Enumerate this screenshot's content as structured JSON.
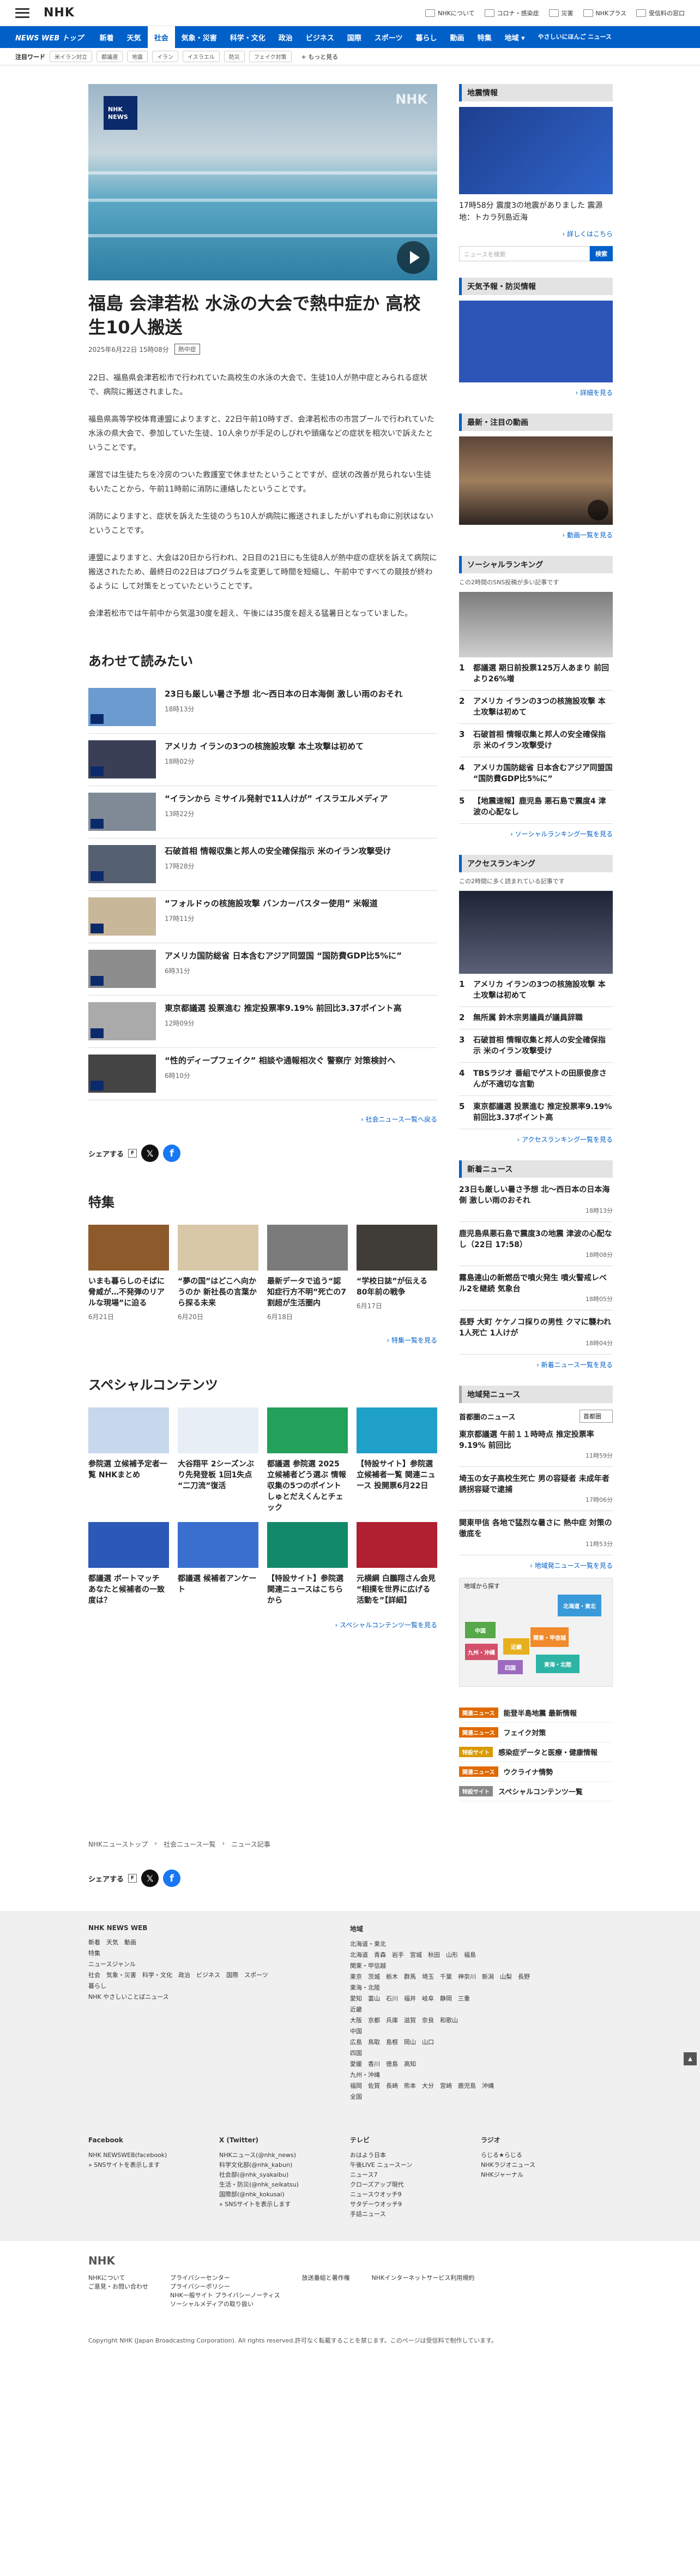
{
  "top": {
    "logo": "NHK",
    "links": [
      "NHKについて",
      "コロナ・感染症",
      "災害",
      "NHKプラス",
      "受信料の窓口"
    ]
  },
  "nav": {
    "brand": "NEWS WEB トップ",
    "items": [
      "新着",
      "天気",
      "社会",
      "気象・災害",
      "科学・文化",
      "政治",
      "ビジネス",
      "国際",
      "スポーツ",
      "暮らし",
      "動画",
      "特集",
      "地域 ▾"
    ],
    "active": "社会",
    "last": "やさしいにほんご ニュース"
  },
  "trend": {
    "label": "注目ワード",
    "chips": [
      "米イラン対立",
      "都議選",
      "地震",
      "イラン",
      "イスラエル",
      "防災",
      "フェイク対策"
    ],
    "more": "+ もっと見る"
  },
  "article": {
    "badge": "NHK NEWS",
    "watermark": "NHK",
    "title": "福島 会津若松 水泳の大会で熱中症か 高校生10人搬送",
    "date": "2025年6月22日 15時08分",
    "tag": "熱中症",
    "paras": [
      "22日、福島県会津若松市で行われていた高校生の水泳の大会で、生徒10人が熱中症とみられる症状で、病院に搬送されました。",
      "福島県高等学校体育連盟によりますと、22日午前10時すぎ、会津若松市の市営プールで行われていた水泳の県大会で、参加していた生徒、10人余りが手足のしびれや頭痛などの症状を相次いで訴えたということです。",
      "運営では生徒たちを冷房のついた救護室で休ませたということですが、症状の改善が見られない生徒もいたことから、午前11時前に消防に連絡したということです。",
      "消防によりますと、症状を訴えた生徒のうち10人が病院に搬送されましたがいずれも命に別状はないということです。",
      "連盟によりますと、大会は20日から行われ、2日目の21日にも生徒8人が熱中症の症状を訴えて病院に搬送されたため、最終日の22日はプログラムを変更して時間を短縮し、午前中ですべての競技が終わるように して対策をとっていたということです。",
      "会津若松市では午前中から気温30度を超え、午後には35度を超える猛暑日となっていました。"
    ]
  },
  "related": {
    "heading": "あわせて読みたい",
    "items": [
      {
        "t": "23日も厳しい暑さ予想 北～西日本の日本海側 激しい雨のおそれ",
        "d": "18時13分",
        "c": "#6c9bd0"
      },
      {
        "t": "アメリカ イランの3つの核施設攻撃 本土攻撃は初めて",
        "d": "18時02分",
        "c": "#3a3f55"
      },
      {
        "t": "“イランから ミサイル発射で11人けが” イスラエルメディア",
        "d": "13時22分",
        "c": "#7f8a96"
      },
      {
        "t": "石破首相 情報収集と邦人の安全確保指示 米のイラン攻撃受け",
        "d": "17時28分",
        "c": "#556070"
      },
      {
        "t": "“フォルドゥの核施設攻撃 バンカーバスター使用” 米報道",
        "d": "17時11分",
        "c": "#c9b79a"
      },
      {
        "t": "アメリカ国防総省 日本含むアジア同盟国 “国防費GDP比5%に”",
        "d": "6時31分",
        "c": "#8d8d8d"
      },
      {
        "t": "東京都議選 投票進む 推定投票率9.19% 前回比3.37ポイント高",
        "d": "12時09分",
        "c": "#aaa"
      },
      {
        "t": "“性的ディープフェイク” 相談や通報相次ぐ 警察庁 対策検討へ",
        "d": "6時10分",
        "c": "#444"
      }
    ],
    "more": "› 社会ニュース一覧へ戻る"
  },
  "share": {
    "label": "シェアする",
    "x": "𝕏",
    "f": "f",
    "fs": "F"
  },
  "tokushu": {
    "heading": "特集",
    "items": [
      {
        "t": "いまも暮らしのそばに脅威が…不発弾のリアルな現場”に迫る",
        "d": "6月21日",
        "c": "#8c5a2b"
      },
      {
        "t": "“夢の国”はどこへ向かうのか 新社長の言葉から探る未来",
        "d": "6月20日",
        "c": "#d8c8a8"
      },
      {
        "t": "最新データで追う“認知症行方不明”死亡の7割超が生活圏内",
        "d": "6月18日",
        "c": "#7a7a7a"
      },
      {
        "t": "“学校日誌”が伝える80年前の戦争",
        "d": "6月17日",
        "c": "#403c38"
      }
    ],
    "more": "› 特集一覧を見る"
  },
  "special": {
    "heading": "スペシャルコンテンツ",
    "items": [
      {
        "t": "参院選 立候補予定者一覧 NHKまとめ",
        "c": "#c7d7ec"
      },
      {
        "t": "大谷翔平 2シーズンぶり先発登板 1回1失点 “二刀流”復活",
        "c": "#e8eef6"
      },
      {
        "t": "都議選 参院選 2025 立候補者どう選ぶ 情報収集の5つのポイント しゅとだえくんとチェック",
        "c": "#23a05a"
      },
      {
        "t": "【特設サイト】参院選 立候補者一覧 関連ニュース 投開票6月22日",
        "c": "#1fa0c8"
      },
      {
        "t": "都議選 ボートマッチ あなたと候補者の一致度は？",
        "c": "#2c58b8"
      },
      {
        "t": "都議選 候補者アンケート",
        "c": "#3a6fd0"
      },
      {
        "t": "【特設サイト】参院選 関連ニュースはこちらから",
        "c": "#128a6a"
      },
      {
        "t": "元横綱 白鵬翔さん会見 “相撲を世界に広げる活動を”【詳細】",
        "c": "#b02030"
      }
    ],
    "more": "› スペシャルコンテンツ一覧を見る"
  },
  "side": {
    "quake": {
      "h": "地震情報",
      "cap": "17時58分 震度3の地震がありました 震源地：トカラ列島近海",
      "link": "› 詳しくはこちら",
      "ph": "ニュースを検索",
      "btn": "検索"
    },
    "weather": {
      "h": "天気予報・防災情報",
      "link": "› 詳細を見る"
    },
    "movie": {
      "h": "最新・注目の動画",
      "link": "› 動画一覧を見る"
    },
    "social": {
      "h": "ソーシャルランキング",
      "sub": "この2時間のSNS投稿が多い記事です",
      "items": [
        "都議選 期日前投票125万人あまり 前回より26%増",
        "アメリカ イランの3つの核施設攻撃 本土攻撃は初めて",
        "石破首相 情報収集と邦人の安全確保指示 米のイラン攻撃受け",
        "アメリカ国防総省 日本含むアジア同盟国 “国防費GDP比5%に”",
        "【地震速報】鹿児島 悪石島で震度4 津波の心配なし"
      ],
      "link": "› ソーシャルランキング一覧を見る"
    },
    "access": {
      "h": "アクセスランキング",
      "sub": "この2時間に多く読まれている記事です",
      "items": [
        "アメリカ イランの3つの核施設攻撃 本土攻撃は初めて",
        "無所属 鈴木宗男議員が議員辞職",
        "石破首相 情報収集と邦人の安全確保指示 米のイラン攻撃受け",
        "TBSラジオ 番組でゲストの田原俊彦さんが不適切な言動",
        "東京都議選 投票進む 推定投票率9.19% 前回比3.37ポイント高"
      ],
      "link": "› アクセスランキング一覧を見る"
    },
    "latest": {
      "h": "新着ニュース",
      "items": [
        {
          "t": "23日も厳しい暑さ予想 北～西日本の日本海側 激しい雨のおそれ",
          "d": "18時13分"
        },
        {
          "t": "鹿児島県悪石島で震度3の地震 津波の心配なし（22日 17:58）",
          "d": "18時08分"
        },
        {
          "t": "霧島連山の新燃岳で噴火発生 噴火警戒レベル2を継続 気象台",
          "d": "18時05分"
        },
        {
          "t": "長野 大町 ケケノコ採りの男性 クマに襲われ 1人死亡 1人けが",
          "d": "18時04分"
        }
      ],
      "link": "› 新着ニュース一覧を見る"
    },
    "region": {
      "h": "地域発ニュース",
      "label": "首都圏のニュース",
      "sel": "首都圏",
      "items": [
        {
          "t": "東京都議選 午前１１時時点 推定投票率 9.19% 前回比",
          "d": "11時59分"
        },
        {
          "t": "埼玉の女子高校生死亡 男の容疑者 未成年者誘拐容疑で逮捕",
          "d": "17時06分"
        },
        {
          "t": "関東甲信 各地で猛烈な暑さに 熱中症 対策の徹底を",
          "d": "11時53分"
        }
      ],
      "link": "› 地域発ニュース一覧を見る",
      "maptitle": "地域から探す",
      "prefs": [
        "北海道・東北",
        "中国",
        "関東・甲信越",
        "九州・沖縄",
        "近畿",
        "四国",
        "東海・北陸"
      ]
    },
    "feat": [
      {
        "lb": "関連ニュース",
        "t": "能登半島地震 最新情報",
        "c": "#e06a00"
      },
      {
        "lb": "関連ニュース",
        "t": "フェイク対策",
        "c": "#e06a00"
      },
      {
        "lb": "特設サイト",
        "t": "感染症データと医療・健康情報",
        "c": "#d89a00"
      },
      {
        "lb": "関連ニュース",
        "t": "ウクライナ情勢",
        "c": "#e06a00"
      },
      {
        "lb": "特設サイト",
        "t": "スペシャルコンテンツ一覧",
        "c": "#888"
      }
    ]
  },
  "crumb": [
    "NHKニューストップ",
    "社会ニュース一覧",
    "ニュース記事"
  ],
  "footer": {
    "c1h": "NHK NEWS WEB",
    "c1": [
      "新着　天気　動画",
      "特集",
      "ニュースジャンル",
      "社会　気象・災害　科学・文化　政治　ビジネス　国際　スポーツ",
      "暮らし",
      "NHK やさしいことばニュース"
    ],
    "c2h": "地域",
    "c2": [
      "北海道・東北",
      "北海道　青森　岩手　宮城　秋田　山形　福島",
      "関東・甲信越",
      "東京　茨城　栃木　群馬　埼玉　千葉　神奈川　新潟　山梨　長野",
      "東海・北陸",
      "愛知　富山　石川　福井　岐阜　静岡　三重",
      "近畿",
      "大阪　京都　兵庫　滋賀　奈良　和歌山",
      "中国",
      "広島　鳥取　島根　岡山　山口",
      "四国",
      "愛媛　香川　徳島　高知",
      "九州・沖縄",
      "福岡　佐賀　長崎　熊本　大分　宮崎　鹿児島　沖縄",
      "全国"
    ],
    "sns": [
      {
        "h": "Facebook",
        "l": [
          "NHK NEWSWEB(facebook)",
          "» SNSサイトを表示します"
        ]
      },
      {
        "h": "X (Twitter)",
        "l": [
          "NHKニュース(@nhk_news)",
          "科学文化部(@nhk_kabun)",
          "社会部(@nhk_syakaibu)",
          "生活・防災(@nhk_seikatsu)",
          "国際部(@nhk_kokusai)",
          "» SNSサイトを表示します"
        ]
      },
      {
        "h": "テレビ",
        "l": [
          "おはよう日本",
          "午後LIVE ニュースーン",
          "ニュース7",
          "クローズアップ現代",
          "ニュースウオッチ9",
          "サタデーウオッチ9",
          "手話ニュース"
        ]
      },
      {
        "h": "ラジオ",
        "l": [
          "らじる★らじる",
          "NHKラジオニュース",
          "NHKジャーナル"
        ]
      }
    ],
    "logo": "NHK",
    "links": [
      [
        "NHKについて",
        "ご意見・お問い合わせ"
      ],
      [
        "プライバシーセンター",
        "プライバシーポリシー",
        "NHK一般サイト プライバシーノーティス",
        "ソーシャルメディアの取り扱い"
      ],
      [
        "放送番組と著作権"
      ],
      [
        "NHKインターネットサービス利用規約"
      ]
    ],
    "copy": "Copyright NHK (Japan Broadcasting Corporation). All rights reserved.許可なく転載することを禁じます。このページは受信料で制作しています。",
    "totop": "▲"
  }
}
